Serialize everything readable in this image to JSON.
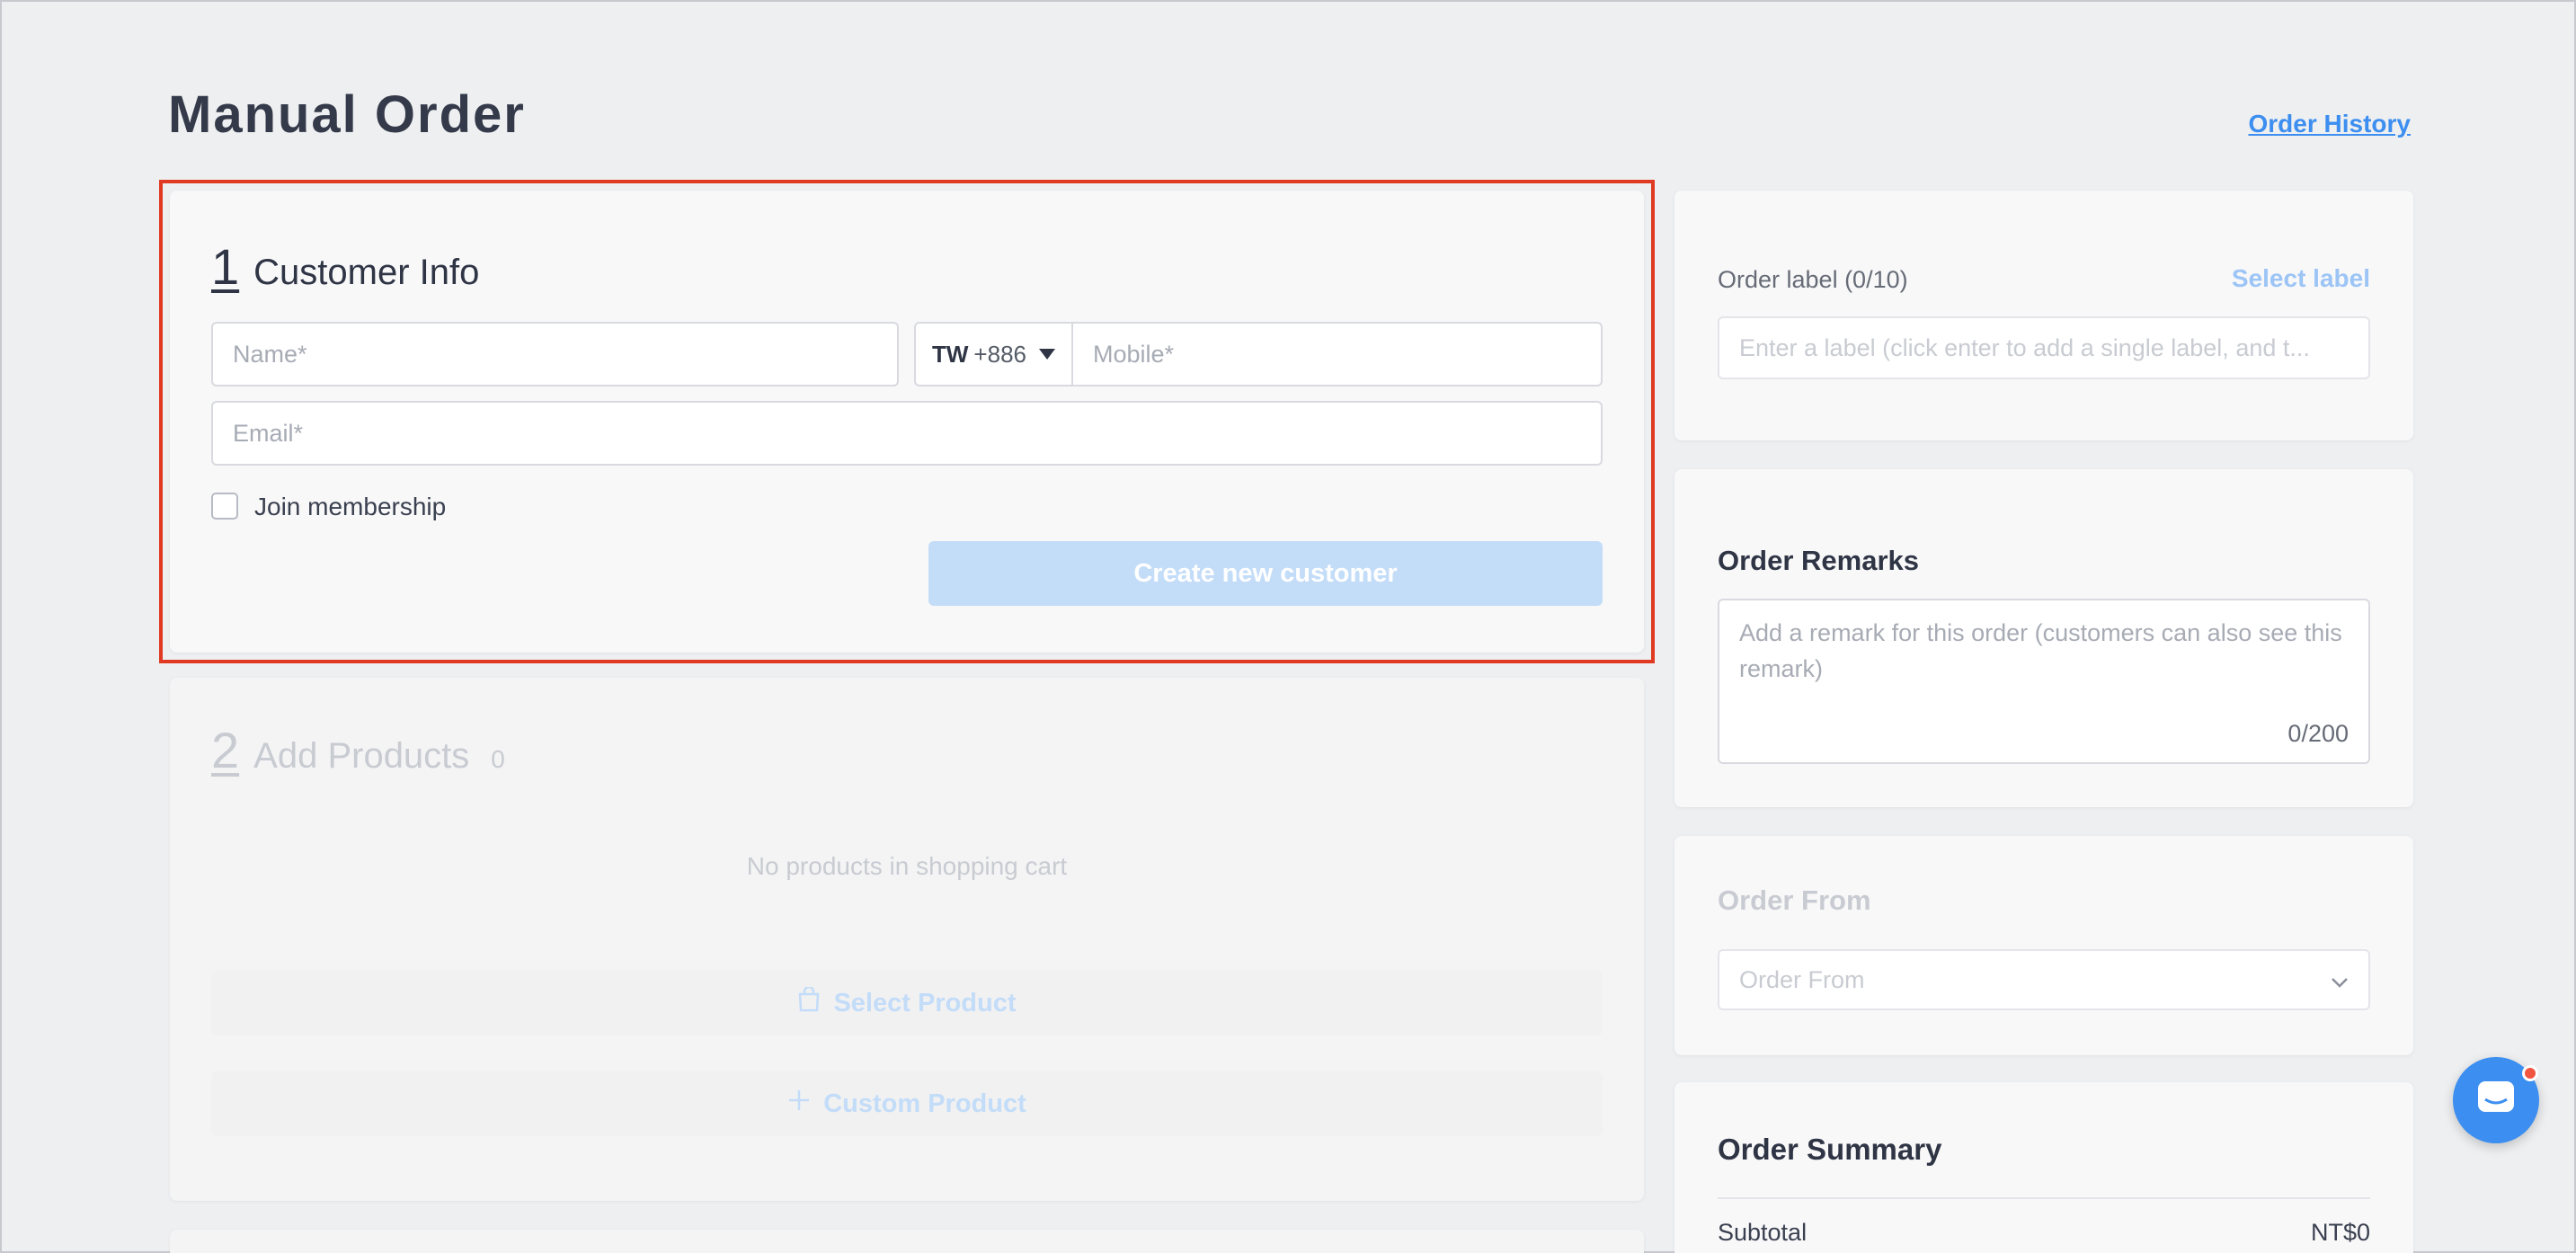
{
  "page": {
    "title": "Manual Order",
    "history_link": "Order History"
  },
  "customer": {
    "step": "1",
    "title": "Customer Info",
    "name_placeholder": "Name*",
    "country_code": "TW",
    "dial_code": "+886",
    "mobile_placeholder": "Mobile*",
    "email_placeholder": "Email*",
    "membership_label": "Join membership",
    "membership_checked": false,
    "create_button": "Create new customer"
  },
  "products": {
    "step": "2",
    "title": "Add Products",
    "count": "0",
    "empty_text": "No products in shopping cart",
    "select_button": "Select Product",
    "custom_button": "Custom Product"
  },
  "order_label": {
    "label": "Order label (0/10)",
    "select_link": "Select label",
    "placeholder": "Enter a label (click enter to add a single label, and t..."
  },
  "remarks": {
    "title": "Order Remarks",
    "placeholder": "Add a remark for this order (customers can also see this remark)",
    "counter": "0/200"
  },
  "order_from": {
    "title": "Order From",
    "placeholder": "Order From"
  },
  "summary": {
    "title": "Order Summary",
    "subtotal_label": "Subtotal",
    "subtotal_value": "NT$0"
  },
  "colors": {
    "accent": "#3c8ef0",
    "highlight": "#e03a22",
    "notification": "#f1543f"
  },
  "icons": [
    "caret-down-icon",
    "shopping-bag-icon",
    "plus-icon",
    "chevron-down-icon",
    "chat-icon"
  ]
}
